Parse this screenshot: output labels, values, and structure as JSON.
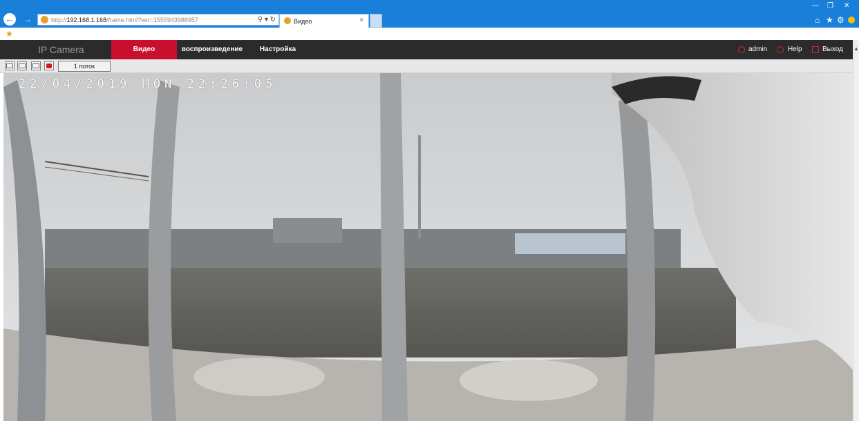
{
  "browser": {
    "url_prefix": "http://",
    "url_host": "192.168.1.168",
    "url_path": "/frame.html?ver=1555943988957",
    "address_tools": "⚲ ▾ ↻",
    "tab_title": "Видео",
    "tab_close": "×",
    "back_glyph": "←",
    "forward_glyph": "→",
    "win_min": "—",
    "win_max": "❐",
    "win_close": "✕",
    "home_glyph": "⌂",
    "star_glyph": "★",
    "gear_glyph": "⚙",
    "favorites_glyph": "★"
  },
  "app": {
    "brand": "IP Camera",
    "nav": {
      "video": "Видео",
      "playback": "воспроизведение",
      "settings": "Настройка"
    },
    "user": "admin",
    "help": "Help",
    "exit": "Выход"
  },
  "toolbar": {
    "stream_label": "1 поток"
  },
  "video": {
    "osd_timestamp": "22/04/2019 MON 22:26:05"
  },
  "colors": {
    "browser_blue": "#1a7fd8",
    "nav_bg": "#2b2b2b",
    "accent_red": "#c8102e"
  }
}
